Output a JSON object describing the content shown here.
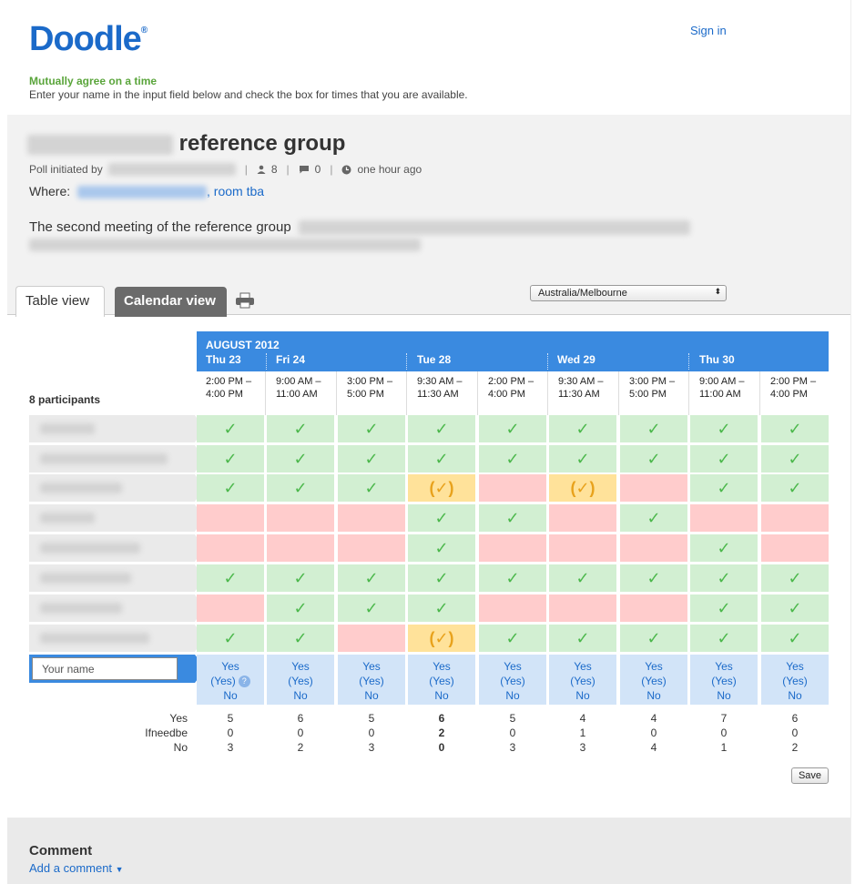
{
  "header": {
    "logo": "Doodle",
    "logo_mark": "®",
    "signin": "Sign in",
    "tagline": "Mutually agree on a time",
    "instructions": "Enter your name in the input field below and check the box for times that you are available."
  },
  "poll": {
    "title": "reference group",
    "initiated_label": "Poll initiated by",
    "participants_count": "8",
    "comments_count": "0",
    "time_ago": "one hour ago",
    "where_label": "Where:",
    "where_suffix": ", room tba",
    "description": "The second meeting of the reference group"
  },
  "tabs": {
    "table": "Table view",
    "calendar": "Calendar view"
  },
  "timezone": "Australia/Melbourne",
  "month": "AUGUST 2012",
  "days": [
    "Thu 23",
    "Fri 24",
    "Tue 28",
    "Wed 29",
    "Thu 30"
  ],
  "times": [
    [
      "2:00 PM –",
      "4:00 PM"
    ],
    [
      "9:00 AM –",
      "11:00 AM"
    ],
    [
      "3:00 PM –",
      "5:00 PM"
    ],
    [
      "9:30 AM –",
      "11:30 AM"
    ],
    [
      "2:00 PM –",
      "4:00 PM"
    ],
    [
      "9:30 AM –",
      "11:30 AM"
    ],
    [
      "3:00 PM –",
      "5:00 PM"
    ],
    [
      "9:00 AM –",
      "11:00 AM"
    ],
    [
      "2:00 PM –",
      "4:00 PM"
    ]
  ],
  "participants_label": "8 participants",
  "votes": [
    [
      "y",
      "y",
      "y",
      "y",
      "y",
      "y",
      "y",
      "y",
      "y"
    ],
    [
      "y",
      "y",
      "y",
      "y",
      "y",
      "y",
      "y",
      "y",
      "y"
    ],
    [
      "y",
      "y",
      "y",
      "m",
      "n",
      "m",
      "n",
      "y",
      "y"
    ],
    [
      "n",
      "n",
      "n",
      "y",
      "y",
      "n",
      "y",
      "n",
      "n"
    ],
    [
      "n",
      "n",
      "n",
      "y",
      "n",
      "n",
      "n",
      "y",
      "n"
    ],
    [
      "y",
      "y",
      "y",
      "y",
      "y",
      "y",
      "y",
      "y",
      "y"
    ],
    [
      "n",
      "y",
      "y",
      "y",
      "n",
      "n",
      "n",
      "y",
      "y"
    ],
    [
      "y",
      "y",
      "n",
      "m",
      "y",
      "y",
      "y",
      "y",
      "y"
    ]
  ],
  "check_glyph": "✓",
  "maybe_glyph": "(✓)",
  "your_name_placeholder": "Your name",
  "options": {
    "yes": "Yes",
    "ifneedbe": "(Yes)",
    "no": "No",
    "help": "?"
  },
  "summary": {
    "labels": [
      "Yes",
      "Ifneedbe",
      "No"
    ],
    "yes": [
      "5",
      "6",
      "5",
      "6",
      "5",
      "4",
      "4",
      "7",
      "6"
    ],
    "ifneedbe": [
      "0",
      "0",
      "0",
      "2",
      "0",
      "1",
      "0",
      "0",
      "0"
    ],
    "no": [
      "3",
      "2",
      "3",
      "0",
      "3",
      "3",
      "4",
      "1",
      "2"
    ],
    "best_column": 3
  },
  "save": "Save",
  "comment": {
    "heading": "Comment",
    "add": "Add a comment"
  }
}
